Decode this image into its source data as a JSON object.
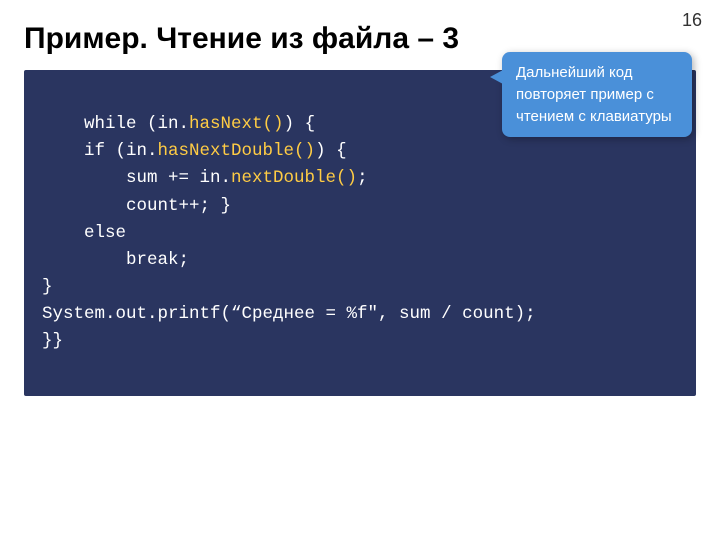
{
  "slide": {
    "number": "16",
    "title": "Пример. Чтение из файла – 3",
    "tooltip": {
      "text": "Дальнейший код повторяет пример с чтением с клавиатуры"
    },
    "code_lines": [
      {
        "parts": [
          {
            "text": "while",
            "type": "kw"
          },
          {
            "text": " (in.",
            "type": "plain"
          },
          {
            "text": "hasNext()",
            "type": "method"
          },
          {
            "text": ") {",
            "type": "plain"
          }
        ]
      },
      {
        "parts": [
          {
            "text": "    if (in.",
            "type": "plain"
          },
          {
            "text": "hasNextDouble()",
            "type": "method"
          },
          {
            "text": ") {",
            "type": "plain"
          }
        ]
      },
      {
        "parts": [
          {
            "text": "        sum += in.",
            "type": "plain"
          },
          {
            "text": "nextDouble()",
            "type": "method"
          },
          {
            "text": ";",
            "type": "plain"
          }
        ]
      },
      {
        "parts": [
          {
            "text": "        count++; }",
            "type": "plain"
          }
        ]
      },
      {
        "parts": [
          {
            "text": "    else",
            "type": "kw"
          }
        ]
      },
      {
        "parts": [
          {
            "text": "        break;",
            "type": "plain"
          }
        ]
      },
      {
        "parts": [
          {
            "text": "}",
            "type": "plain"
          }
        ]
      },
      {
        "parts": [
          {
            "text": "System.out.printf(“Среднее = %f\", sum / count);",
            "type": "plain"
          }
        ]
      },
      {
        "parts": [
          {
            "text": "}}",
            "type": "plain"
          }
        ]
      }
    ]
  }
}
